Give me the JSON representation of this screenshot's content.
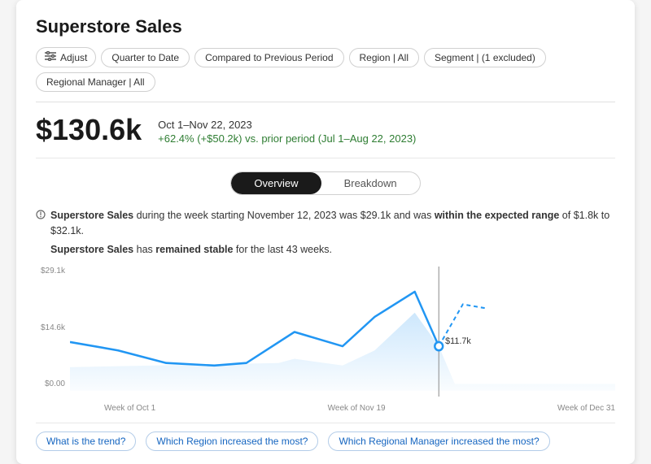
{
  "title": "Superstore Sales",
  "filters": [
    {
      "id": "adjust",
      "label": "Adjust",
      "icon": "adjust-icon"
    },
    {
      "id": "quarter",
      "label": "Quarter to Date"
    },
    {
      "id": "compared",
      "label": "Compared to Previous Period"
    },
    {
      "id": "region",
      "label": "Region | All"
    },
    {
      "id": "segment",
      "label": "Segment | (1 excluded)"
    },
    {
      "id": "manager",
      "label": "Regional Manager | All"
    }
  ],
  "metric": {
    "value": "$130.6k",
    "period": "Oct 1–Nov 22, 2023",
    "change": "+62.4% (+$50.2k) vs. prior period (Jul 1–Aug 22, 2023)"
  },
  "tabs": [
    {
      "id": "overview",
      "label": "Overview",
      "active": true
    },
    {
      "id": "breakdown",
      "label": "Breakdown",
      "active": false
    }
  ],
  "insight": {
    "line1_normal": "Superstore Sales during the week starting November 12, 2023 was $29.1k and was ",
    "line1_bold": "within the expected range",
    "line1_end": " of $1.8k to $32.1k.",
    "line2_start": "Superstore Sales has ",
    "line2_bold": "remained stable",
    "line2_end": " for the last 43 weeks."
  },
  "chart": {
    "yLabels": [
      "$29.1k",
      "$14.6k",
      "$0.00"
    ],
    "xLabels": [
      "Week of Oct 1",
      "Week of Nov 19",
      "Week of Dec 31"
    ],
    "dataPoint": "$11.7k",
    "accentColor": "#2196F3"
  },
  "questions": [
    {
      "id": "trend",
      "label": "What is the trend?"
    },
    {
      "id": "region-increase",
      "label": "Which Region increased the most?"
    },
    {
      "id": "manager-increase",
      "label": "Which Regional Manager increased the most?"
    }
  ]
}
